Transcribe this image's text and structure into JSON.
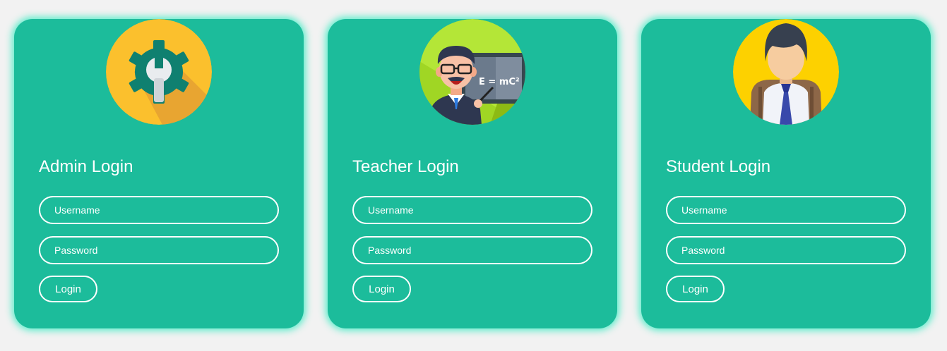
{
  "colors": {
    "page_background": "#f2f2f2",
    "card_background": "#1cbc9b",
    "card_glow": "#40ebc3",
    "text": "#ffffff"
  },
  "cards": [
    {
      "icon": "admin-gear-wrench-icon",
      "title": "Admin Login",
      "username_placeholder": "Username",
      "password_placeholder": "Password",
      "button_label": "Login"
    },
    {
      "icon": "teacher-avatar-icon",
      "title": "Teacher Login",
      "board_text": "E = mC²",
      "username_placeholder": "Username",
      "password_placeholder": "Password",
      "button_label": "Login"
    },
    {
      "icon": "student-avatar-icon",
      "title": "Student Login",
      "username_placeholder": "Username",
      "password_placeholder": "Password",
      "button_label": "Login"
    }
  ]
}
